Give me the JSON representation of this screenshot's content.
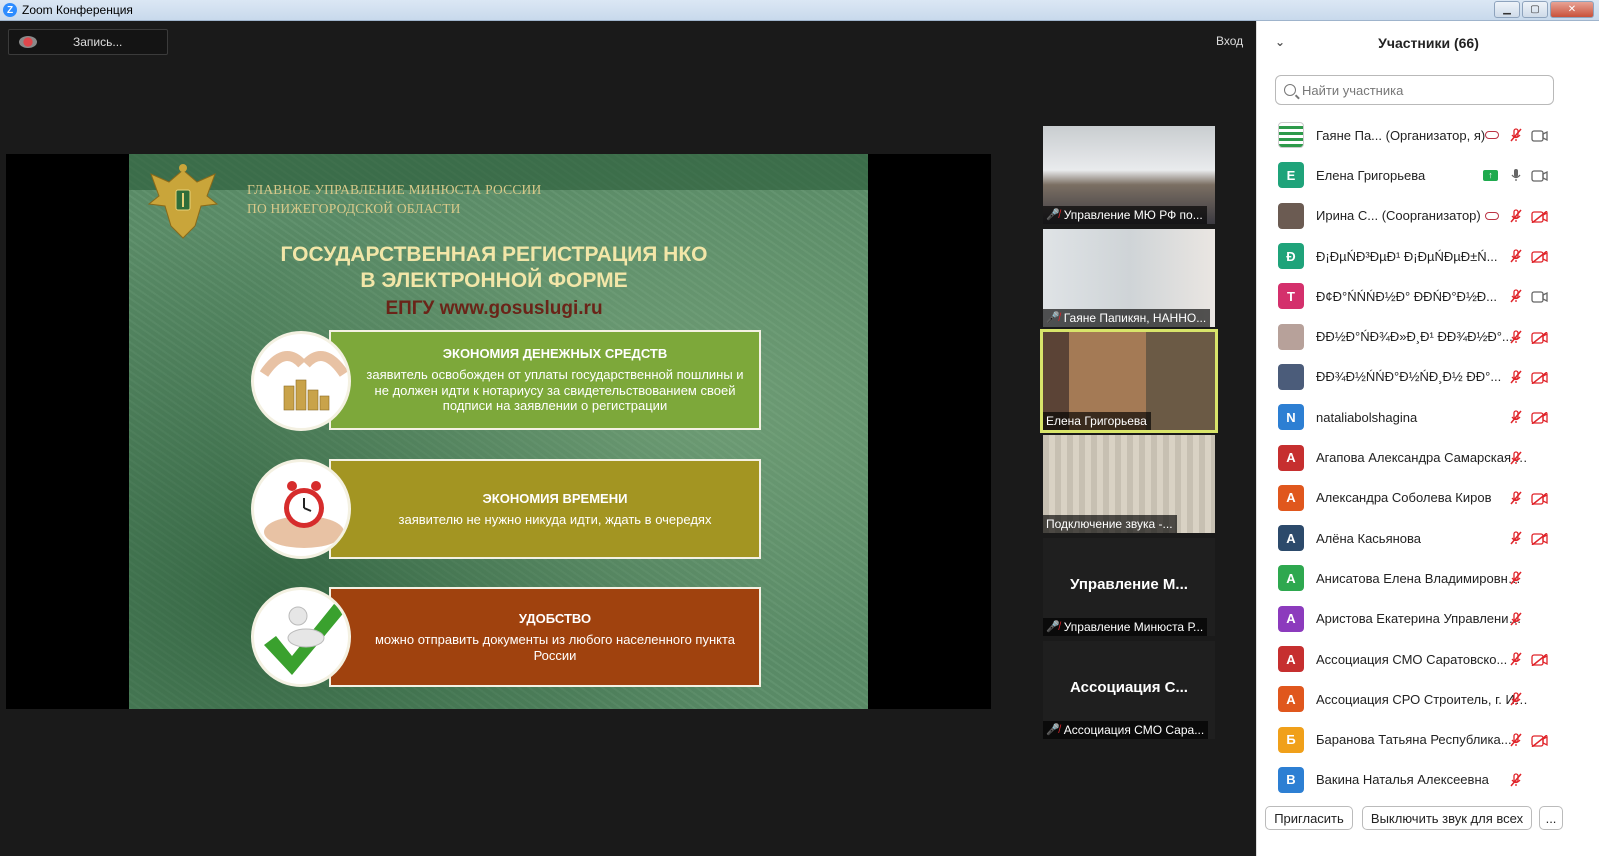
{
  "window": {
    "title": "Zoom Конференция",
    "logo_letter": "Z"
  },
  "main": {
    "recording_label": "Запись...",
    "login_label": "Вход"
  },
  "slide": {
    "ministry_line1": "ГЛАВНОЕ УПРАВЛЕНИЕ МИНЮСТА РОССИИ",
    "ministry_line2": "ПО НИЖЕГОРОДСКОЙ ОБЛАСТИ",
    "title_line1": "ГОСУДАРСТВЕННАЯ РЕГИСТРАЦИЯ НКО",
    "title_line2": "В ЭЛЕКТРОННОЙ ФОРМЕ",
    "subtitle": "ЕПГУ www.gosuslugi.ru",
    "items": [
      {
        "heading": "ЭКОНОМИЯ ДЕНЕЖНЫХ СРЕДСТВ",
        "text": "заявитель освобожден от уплаты государственной пошлины и не должен идти к нотариусу за свидетельствованием своей подписи на заявлении о регистрации"
      },
      {
        "heading": "ЭКОНОМИЯ ВРЕМЕНИ",
        "text": "заявителю не нужно никуда идти, ждать в очередях"
      },
      {
        "heading": "УДОБСТВО",
        "text": "можно отправить документы из любого населенного пункта России"
      }
    ]
  },
  "videos": [
    {
      "label": "Управление МЮ РФ по...",
      "muted": true
    },
    {
      "label": "Гаяне Папикян, НАННО...",
      "muted": true
    },
    {
      "label": "Елена Григорьева",
      "muted": false
    },
    {
      "label": "Подключение звука -...",
      "muted": false
    },
    {
      "big_name": "Управление М...",
      "label": "Управление Минюста Р...",
      "muted": true
    },
    {
      "big_name": "Ассоциация С...",
      "label": "Ассоциация СМО Сара...",
      "muted": true
    }
  ],
  "panel": {
    "title": "Участники (66)",
    "search_placeholder": "Найти участника",
    "invite_label": "Пригласить",
    "mute_all_label": "Выключить звук для всех",
    "more_label": "...",
    "participants": [
      {
        "initial": "",
        "color": "#ffffff",
        "name": "Гаяне Па... (Организатор, я)",
        "extra": "cloud",
        "mic": "muted",
        "cam": "on"
      },
      {
        "initial": "Е",
        "color": "#1fa37a",
        "name": "Елена Григорьева",
        "extra": "share",
        "mic": "on",
        "cam": "on"
      },
      {
        "initial": "",
        "color": "#6b5b52",
        "name": "Ирина С... (Соорганизатор)",
        "extra": "cloud",
        "mic": "muted",
        "cam": "off"
      },
      {
        "initial": "Ð",
        "color": "#1fa37a",
        "name": "Đ¡ĐµŃĐ³ĐµĐ¹ Đ¡ĐµŃĐµĐ±Ń...",
        "extra": "",
        "mic": "muted",
        "cam": "off"
      },
      {
        "initial": "Т",
        "color": "#d4306c",
        "name": "Đ¢Đ°ŃŃŃĐ½Đ° ĐĐŃĐ°Đ½Đ...",
        "extra": "",
        "mic": "muted",
        "cam": "on"
      },
      {
        "initial": "",
        "color": "#b7a19a",
        "name": "ĐĐ½Đ°ŃĐ¾Đ»Đ¸Đ¹ ĐĐ¾Đ½Đ°...",
        "extra": "",
        "mic": "muted",
        "cam": "off"
      },
      {
        "initial": "",
        "color": "#4b5c7a",
        "name": "ĐĐ¾Đ½ŃŃĐ°Đ½ŃĐ¸Đ½ ĐĐ°...",
        "extra": "",
        "mic": "muted",
        "cam": "off"
      },
      {
        "initial": "N",
        "color": "#2d7fd3",
        "name": "nataliabolshagina",
        "extra": "",
        "mic": "muted",
        "cam": "off"
      },
      {
        "initial": "А",
        "color": "#c62f2f",
        "name": "Агапова Александра Самарская о...",
        "extra": "",
        "mic": "muted",
        "cam": ""
      },
      {
        "initial": "А",
        "color": "#e0571d",
        "name": "Александра Соболева Киров",
        "extra": "",
        "mic": "muted",
        "cam": "off"
      },
      {
        "initial": "А",
        "color": "#2c4a6b",
        "name": "Алёна Касьянова",
        "extra": "",
        "mic": "muted",
        "cam": "off"
      },
      {
        "initial": "А",
        "color": "#2ea84f",
        "name": "Анисатова Елена Владимировна С...",
        "extra": "",
        "mic": "muted",
        "cam": ""
      },
      {
        "initial": "А",
        "color": "#8c3bbd",
        "name": "Аристова Екатерина Управление ...",
        "extra": "",
        "mic": "muted",
        "cam": ""
      },
      {
        "initial": "А",
        "color": "#c62f2f",
        "name": "Ассоциация СМО Саратовско...",
        "extra": "",
        "mic": "muted",
        "cam": "off"
      },
      {
        "initial": "А",
        "color": "#e0571d",
        "name": "Ассоциация СРО Строитель, г. Иж...",
        "extra": "",
        "mic": "muted",
        "cam": ""
      },
      {
        "initial": "Б",
        "color": "#f0a01a",
        "name": "Баранова Татьяна Республика...",
        "extra": "",
        "mic": "muted",
        "cam": "off"
      },
      {
        "initial": "В",
        "color": "#2d7fd3",
        "name": "Вакина Наталья Алексеевна",
        "extra": "",
        "mic": "muted",
        "cam": ""
      }
    ]
  },
  "colors": {
    "accent": "#2d8cff",
    "active_speaker": "#d8e46a",
    "muted_red": "#e0242a"
  }
}
